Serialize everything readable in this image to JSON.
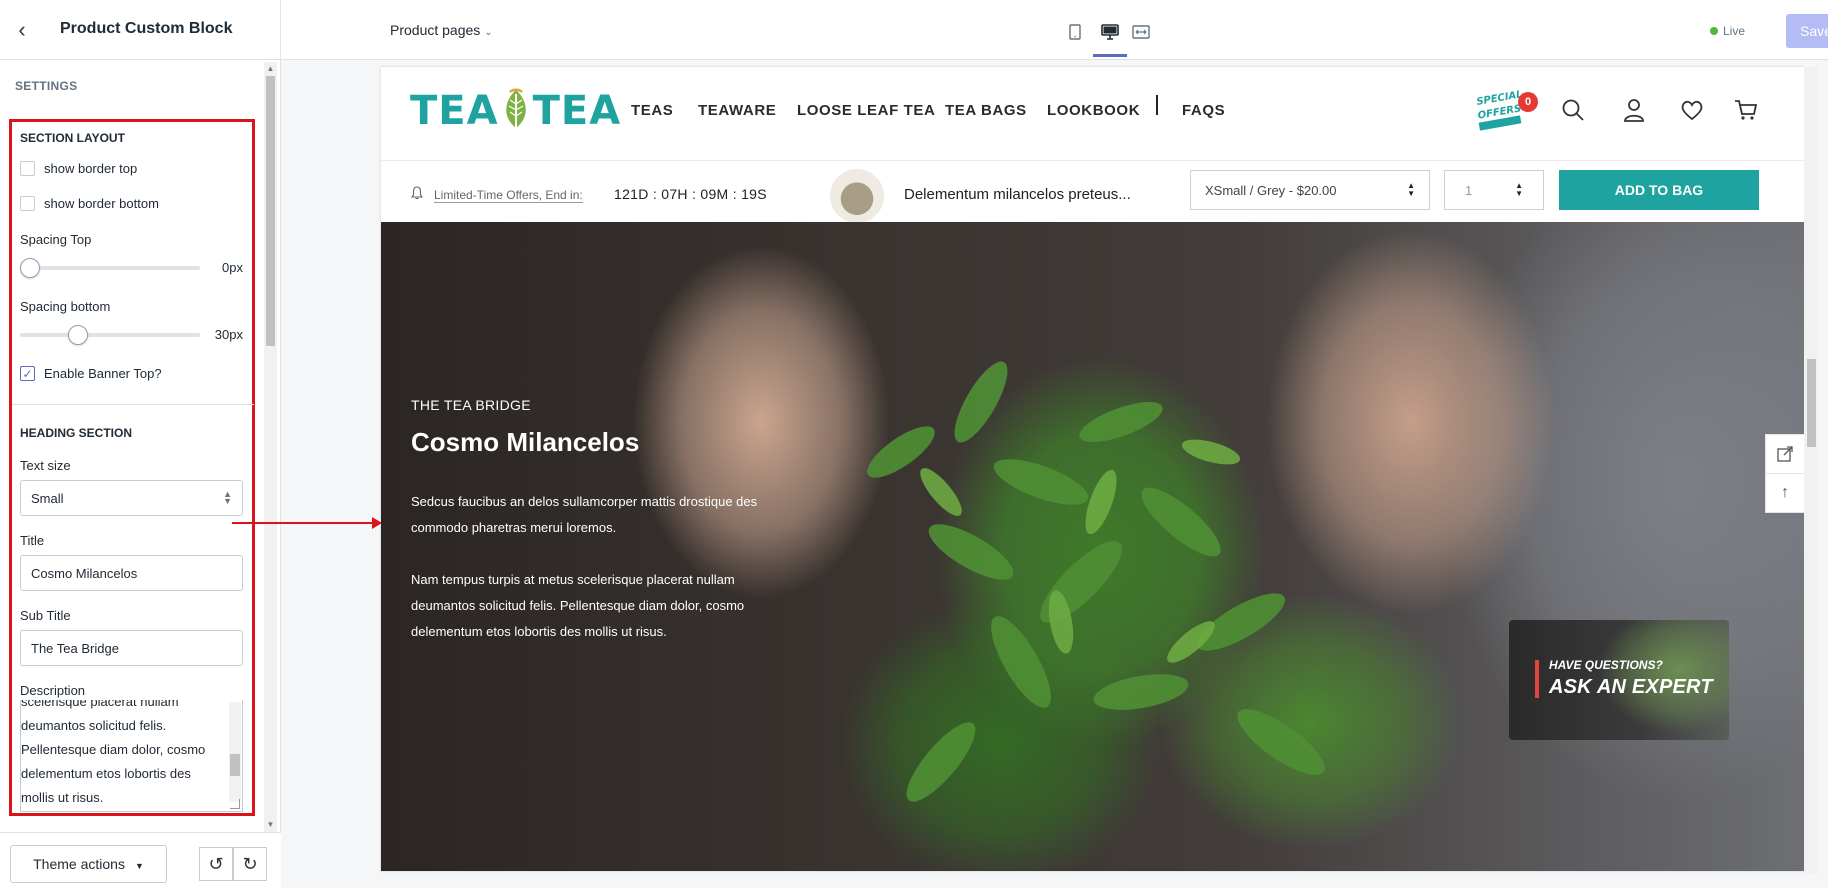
{
  "sidebar": {
    "title": "Product Custom Block",
    "settings_label": "SETTINGS",
    "section_layout": {
      "heading": "SECTION LAYOUT",
      "show_border_top": {
        "label": "show border top",
        "checked": false
      },
      "show_border_bottom": {
        "label": "show border bottom",
        "checked": false
      },
      "spacing_top": {
        "label": "Spacing Top",
        "value": 0,
        "value_text": "0px"
      },
      "spacing_bottom": {
        "label": "Spacing bottom",
        "value": 30,
        "value_text": "30px"
      },
      "enable_banner_top": {
        "label": "Enable Banner Top?",
        "checked": true
      }
    },
    "heading_section": {
      "heading": "HEADING SECTION",
      "text_size": {
        "label": "Text size",
        "value": "Small"
      },
      "title": {
        "label": "Title",
        "value": "Cosmo Milancelos"
      },
      "sub_title": {
        "label": "Sub Title",
        "value": "The Tea Bridge"
      },
      "description": {
        "label": "Description",
        "visible_text": "scelerisque placerat nullam\ndeumantos solicitud felis.\nPellentesque diam dolor, cosmo\ndelementum etos lobortis des\nmollis ut risus."
      }
    },
    "footer": {
      "theme_actions": "Theme actions"
    }
  },
  "topbar": {
    "page_selector": "Product pages",
    "live_label": "Live",
    "save_label": "Save",
    "colors": {
      "accent": "#5c6ac4",
      "save_bg": "#b3bcf5",
      "live_dot": "#50b83c"
    }
  },
  "store": {
    "logo_text_left": "TEA",
    "logo_text_right": "TEA",
    "nav": [
      "TEAS",
      "TEAWARE",
      "LOOSE LEAF TEA",
      "TEA BAGS",
      "LOOKBOOK",
      "FAQS"
    ],
    "special_badge": "SPECIAL OFFERS",
    "cart_count": "0",
    "brand_color": "#1fa3a0"
  },
  "sticky": {
    "offer_label": "Limited-Time Offers, End in:",
    "countdown": "121D : 07H : 09M : 19S",
    "product_name": "Delementum milancelos preteus...",
    "variant": "XSmall / Grey - $20.00",
    "qty": "1",
    "add_to_bag": "ADD TO BAG"
  },
  "banner": {
    "sub_title": "THE TEA BRIDGE",
    "title": "Cosmo Milancelos",
    "description": "Sedcus faucibus an delos sullamcorper mattis drostique des\ncommodo pharetras merui loremos.\n\nNam tempus turpis at metus scelerisque placerat nullam\ndeumantos solicitud felis. Pellentesque diam dolor, cosmo\ndelementum etos lobortis des mollis ut risus.",
    "expert_question": "HAVE QUESTIONS?",
    "expert_title": "ASK AN EXPERT"
  }
}
